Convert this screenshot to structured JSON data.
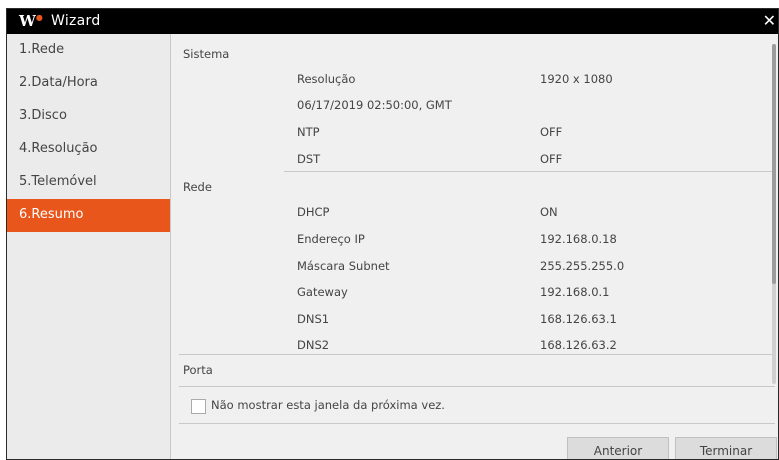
{
  "window": {
    "logo": "W",
    "title": "Wizard",
    "close_icon": "close-icon"
  },
  "sidebar": {
    "items": [
      {
        "label": "1.Rede"
      },
      {
        "label": "2.Data/Hora"
      },
      {
        "label": "3.Disco"
      },
      {
        "label": "4.Resolução"
      },
      {
        "label": "5.Telemóvel"
      },
      {
        "label": "6.Resumo",
        "active": true
      }
    ]
  },
  "summary": {
    "sistema": {
      "title": "Sistema",
      "resolution_label": "Resolução",
      "resolution_value": "1920 x 1080",
      "datetime": "06/17/2019 02:50:00, GMT",
      "ntp_label": "NTP",
      "ntp_value": "OFF",
      "dst_label": "DST",
      "dst_value": "OFF"
    },
    "rede": {
      "title": "Rede",
      "dhcp_label": "DHCP",
      "dhcp_value": "ON",
      "ip_label": "Endereço IP",
      "ip_value": "192.168.0.18",
      "subnet_label": "Máscara Subnet",
      "subnet_value": "255.255.255.0",
      "gateway_label": "Gateway",
      "gateway_value": "192.168.0.1",
      "dns1_label": "DNS1",
      "dns1_value": "168.126.63.1",
      "dns2_label": "DNS2",
      "dns2_value": "168.126.63.2"
    },
    "porta": {
      "title": "Porta"
    }
  },
  "footer": {
    "dont_show_label": "Não mostrar esta janela da próxima vez.",
    "dont_show_checked": false,
    "prev_label": "Anterior",
    "finish_label": "Terminar"
  },
  "colors": {
    "accent": "#e8561b",
    "titlebar": "#000000",
    "background": "#f0f0f0"
  }
}
